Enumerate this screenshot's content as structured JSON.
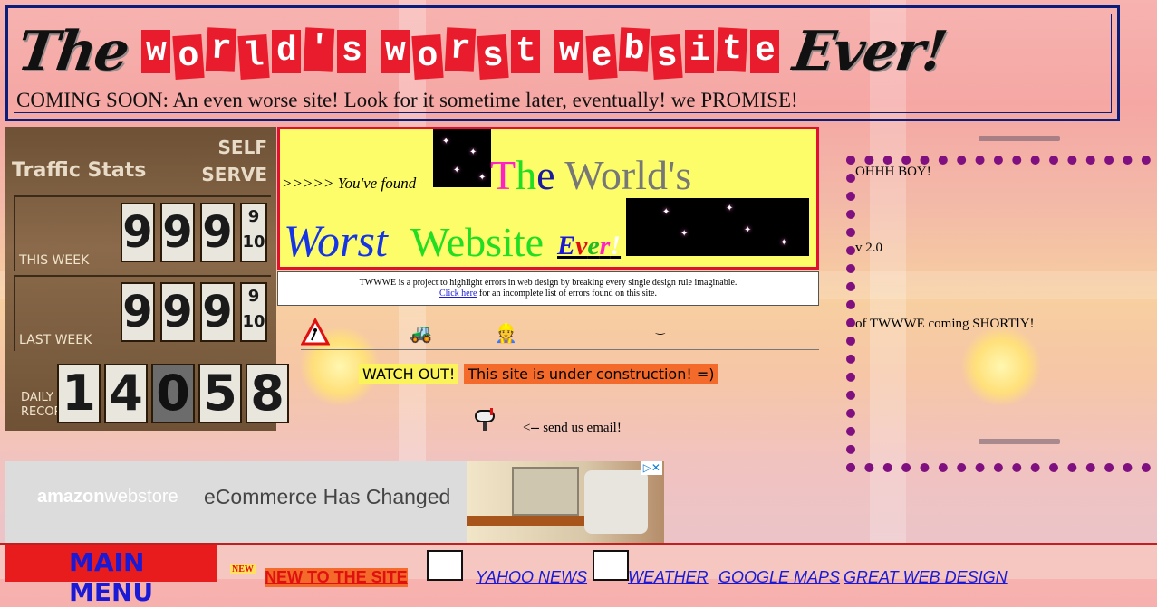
{
  "header": {
    "title_script_1": "The",
    "title_ransom_1": "world's",
    "title_ransom_2": "worst",
    "title_ransom_3": "website",
    "title_script_2": "Ever!",
    "coming_soon": "COMING SOON: An even worse site! Look for it sometime later, eventually!  we PROMISE!"
  },
  "traffic": {
    "title": "Traffic Stats",
    "self": "SELF",
    "serve": "SERVE",
    "this_week_label": "THIS WEEK",
    "this_week_digits": [
      "9",
      "9",
      "9"
    ],
    "this_week_frac_top": "9",
    "this_week_frac_bottom": "10",
    "last_week_label": "LAST WEEK",
    "last_week_digits": [
      "9",
      "9",
      "9"
    ],
    "last_week_frac_top": "9",
    "last_week_frac_bottom": "10",
    "daily_label_1": "DAILY",
    "daily_label_2": "RECOR",
    "daily_digits": [
      "1",
      "4",
      "0",
      "5",
      "8"
    ]
  },
  "banner": {
    "found": ">>>>> You've found",
    "the_T": "T",
    "the_h": "h",
    "the_e": "e",
    "worlds": "World's",
    "worst": "Worst",
    "website": "Website",
    "ever_E": "E",
    "ever_v": "v",
    "ever_e": "e",
    "ever_r": "r",
    "ever_bang": "!"
  },
  "info": {
    "line1": "TWWWE is a project to highlight errors in web design by breaking every single design rule imaginable.",
    "link": "Click here",
    "line2": " for an incomplete list of errors found on this site."
  },
  "construction": {
    "watch_out": "WATCH OUT!",
    "under_construction": "This site is under construction! =)",
    "send_email": "<-- send us email!"
  },
  "sidebar": {
    "line1": "OHHH BOY!",
    "line2": "v 2.0",
    "line3": "of TWWWE coming SHORTlY!"
  },
  "ad": {
    "logo_bold": "amazon",
    "logo_rest": "webstore",
    "headline": "eCommerce Has Changed",
    "adchoices": "▷✕"
  },
  "nav": {
    "main_menu": "MAIN MENU",
    "new_badge": "NEW",
    "new_to_site": "NEW TO THE SITE",
    "yahoo": "YAHOO NEWS",
    "weather": "WEATHER",
    "google": "GOOGLE MAPS",
    "great": "GREAT WEB DESIGN"
  },
  "colors": {
    "header_border": "#0b1d7a",
    "banner_bg": "#fdfd6a",
    "banner_border": "#e01030",
    "dotted": "#801080"
  }
}
